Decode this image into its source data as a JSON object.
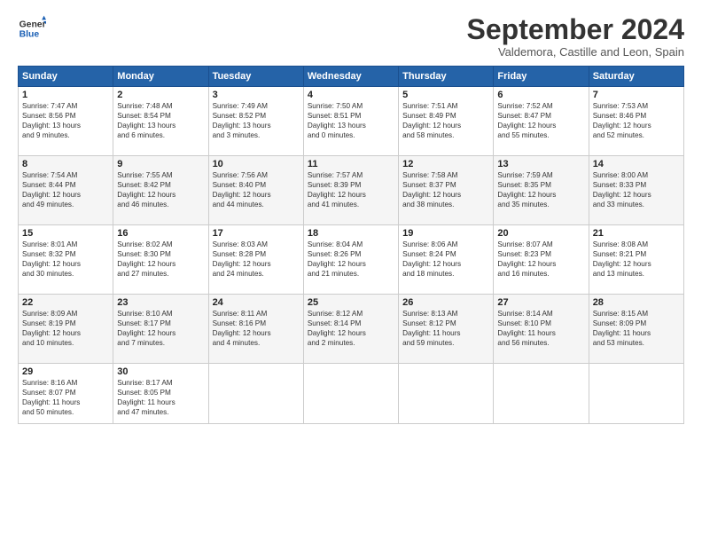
{
  "header": {
    "logo_line1": "General",
    "logo_line2": "Blue",
    "month": "September 2024",
    "location": "Valdemora, Castille and Leon, Spain"
  },
  "weekdays": [
    "Sunday",
    "Monday",
    "Tuesday",
    "Wednesday",
    "Thursday",
    "Friday",
    "Saturday"
  ],
  "weeks": [
    [
      {
        "day": "1",
        "info": "Sunrise: 7:47 AM\nSunset: 8:56 PM\nDaylight: 13 hours\nand 9 minutes."
      },
      {
        "day": "2",
        "info": "Sunrise: 7:48 AM\nSunset: 8:54 PM\nDaylight: 13 hours\nand 6 minutes."
      },
      {
        "day": "3",
        "info": "Sunrise: 7:49 AM\nSunset: 8:52 PM\nDaylight: 13 hours\nand 3 minutes."
      },
      {
        "day": "4",
        "info": "Sunrise: 7:50 AM\nSunset: 8:51 PM\nDaylight: 13 hours\nand 0 minutes."
      },
      {
        "day": "5",
        "info": "Sunrise: 7:51 AM\nSunset: 8:49 PM\nDaylight: 12 hours\nand 58 minutes."
      },
      {
        "day": "6",
        "info": "Sunrise: 7:52 AM\nSunset: 8:47 PM\nDaylight: 12 hours\nand 55 minutes."
      },
      {
        "day": "7",
        "info": "Sunrise: 7:53 AM\nSunset: 8:46 PM\nDaylight: 12 hours\nand 52 minutes."
      }
    ],
    [
      {
        "day": "8",
        "info": "Sunrise: 7:54 AM\nSunset: 8:44 PM\nDaylight: 12 hours\nand 49 minutes."
      },
      {
        "day": "9",
        "info": "Sunrise: 7:55 AM\nSunset: 8:42 PM\nDaylight: 12 hours\nand 46 minutes."
      },
      {
        "day": "10",
        "info": "Sunrise: 7:56 AM\nSunset: 8:40 PM\nDaylight: 12 hours\nand 44 minutes."
      },
      {
        "day": "11",
        "info": "Sunrise: 7:57 AM\nSunset: 8:39 PM\nDaylight: 12 hours\nand 41 minutes."
      },
      {
        "day": "12",
        "info": "Sunrise: 7:58 AM\nSunset: 8:37 PM\nDaylight: 12 hours\nand 38 minutes."
      },
      {
        "day": "13",
        "info": "Sunrise: 7:59 AM\nSunset: 8:35 PM\nDaylight: 12 hours\nand 35 minutes."
      },
      {
        "day": "14",
        "info": "Sunrise: 8:00 AM\nSunset: 8:33 PM\nDaylight: 12 hours\nand 33 minutes."
      }
    ],
    [
      {
        "day": "15",
        "info": "Sunrise: 8:01 AM\nSunset: 8:32 PM\nDaylight: 12 hours\nand 30 minutes."
      },
      {
        "day": "16",
        "info": "Sunrise: 8:02 AM\nSunset: 8:30 PM\nDaylight: 12 hours\nand 27 minutes."
      },
      {
        "day": "17",
        "info": "Sunrise: 8:03 AM\nSunset: 8:28 PM\nDaylight: 12 hours\nand 24 minutes."
      },
      {
        "day": "18",
        "info": "Sunrise: 8:04 AM\nSunset: 8:26 PM\nDaylight: 12 hours\nand 21 minutes."
      },
      {
        "day": "19",
        "info": "Sunrise: 8:06 AM\nSunset: 8:24 PM\nDaylight: 12 hours\nand 18 minutes."
      },
      {
        "day": "20",
        "info": "Sunrise: 8:07 AM\nSunset: 8:23 PM\nDaylight: 12 hours\nand 16 minutes."
      },
      {
        "day": "21",
        "info": "Sunrise: 8:08 AM\nSunset: 8:21 PM\nDaylight: 12 hours\nand 13 minutes."
      }
    ],
    [
      {
        "day": "22",
        "info": "Sunrise: 8:09 AM\nSunset: 8:19 PM\nDaylight: 12 hours\nand 10 minutes."
      },
      {
        "day": "23",
        "info": "Sunrise: 8:10 AM\nSunset: 8:17 PM\nDaylight: 12 hours\nand 7 minutes."
      },
      {
        "day": "24",
        "info": "Sunrise: 8:11 AM\nSunset: 8:16 PM\nDaylight: 12 hours\nand 4 minutes."
      },
      {
        "day": "25",
        "info": "Sunrise: 8:12 AM\nSunset: 8:14 PM\nDaylight: 12 hours\nand 2 minutes."
      },
      {
        "day": "26",
        "info": "Sunrise: 8:13 AM\nSunset: 8:12 PM\nDaylight: 11 hours\nand 59 minutes."
      },
      {
        "day": "27",
        "info": "Sunrise: 8:14 AM\nSunset: 8:10 PM\nDaylight: 11 hours\nand 56 minutes."
      },
      {
        "day": "28",
        "info": "Sunrise: 8:15 AM\nSunset: 8:09 PM\nDaylight: 11 hours\nand 53 minutes."
      }
    ],
    [
      {
        "day": "29",
        "info": "Sunrise: 8:16 AM\nSunset: 8:07 PM\nDaylight: 11 hours\nand 50 minutes."
      },
      {
        "day": "30",
        "info": "Sunrise: 8:17 AM\nSunset: 8:05 PM\nDaylight: 11 hours\nand 47 minutes."
      },
      {
        "day": "",
        "info": ""
      },
      {
        "day": "",
        "info": ""
      },
      {
        "day": "",
        "info": ""
      },
      {
        "day": "",
        "info": ""
      },
      {
        "day": "",
        "info": ""
      }
    ]
  ]
}
